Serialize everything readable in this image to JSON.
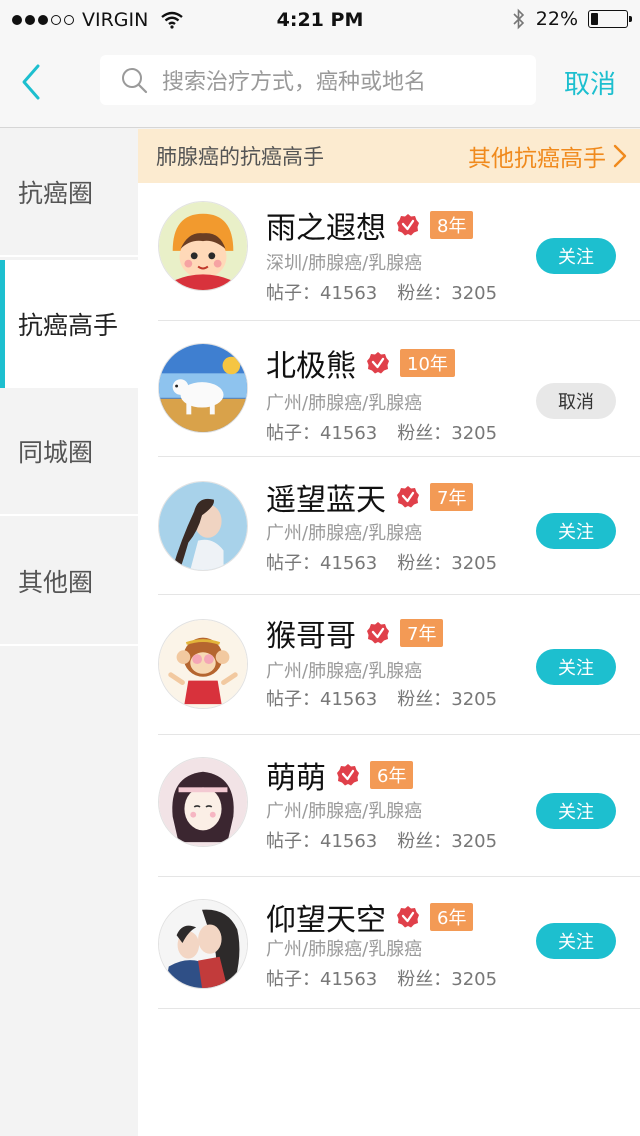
{
  "status_bar": {
    "carrier": "VIRGIN",
    "time": "4:21 PM",
    "battery": "22%",
    "battery_level": 0.22
  },
  "nav": {
    "search_placeholder": "搜索治疗方式，癌种或地名",
    "cancel_label": "取消"
  },
  "sidebar": {
    "items": [
      {
        "label": "抗癌圈"
      },
      {
        "label": "抗癌高手"
      },
      {
        "label": "同城圈"
      },
      {
        "label": "其他圈"
      }
    ],
    "active_index": 1
  },
  "banner": {
    "title": "肺腺癌的抗癌高手",
    "link": "其他抗癌高手"
  },
  "experts": [
    {
      "name": "雨之遐想",
      "years": "8年",
      "location": "深圳/肺腺癌/乳腺癌",
      "posts": "帖子：41563",
      "fans": "粉丝：3205",
      "button": "关注",
      "following": false,
      "avatar": "cartoon-girl-orange-hat"
    },
    {
      "name": "北极熊",
      "years": "10年",
      "location": "广州/肺腺癌/乳腺癌",
      "posts": "帖子：41563",
      "fans": "粉丝：3205",
      "button": "取消",
      "following": true,
      "avatar": "polar-bear"
    },
    {
      "name": "遥望蓝天",
      "years": "7年",
      "location": "广州/肺腺癌/乳腺癌",
      "posts": "帖子：41563",
      "fans": "粉丝：3205",
      "button": "关注",
      "following": false,
      "avatar": "woman-braid-sky"
    },
    {
      "name": "猴哥哥",
      "years": "7年",
      "location": "广州/肺腺癌/乳腺癌",
      "posts": "帖子：41563",
      "fans": "粉丝：3205",
      "button": "关注",
      "following": false,
      "avatar": "cartoon-monkey"
    },
    {
      "name": "萌萌",
      "years": "6年",
      "location": "广州/肺腺癌/乳腺癌",
      "posts": "帖子：41563",
      "fans": "粉丝：3205",
      "button": "关注",
      "following": false,
      "avatar": "cartoon-girl-headband"
    },
    {
      "name": "仰望天空",
      "years": "6年",
      "location": "广州/肺腺癌/乳腺癌",
      "posts": "帖子：41563",
      "fans": "粉丝：3205",
      "button": "关注",
      "following": false,
      "avatar": "illustrated-couple"
    }
  ],
  "colors": {
    "accent": "#1dbfcf",
    "orange_link": "#f08a1d",
    "years_badge": "#f39a55",
    "verified_badge": "#e0404a",
    "banner_bg": "#fcebd0"
  }
}
